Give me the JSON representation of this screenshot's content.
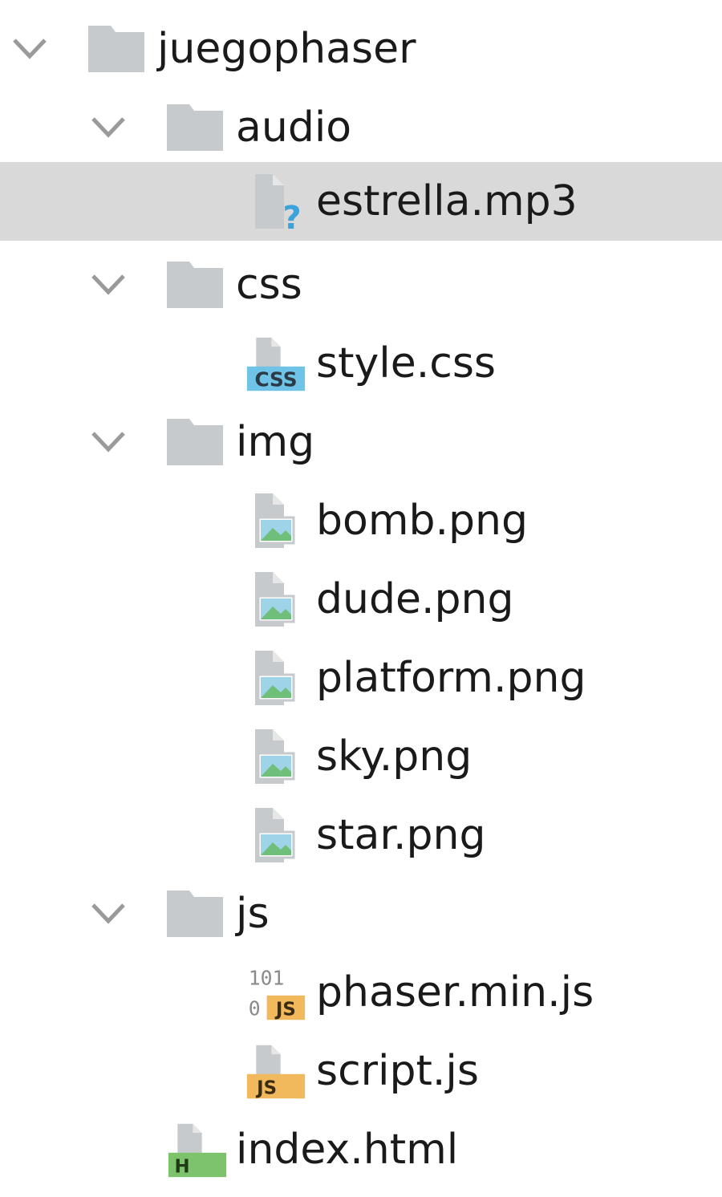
{
  "tree": {
    "root": {
      "label": "juegophaser",
      "icon": "folder-icon",
      "expanded": true
    },
    "audio": {
      "label": "audio",
      "icon": "folder-icon",
      "expanded": true
    },
    "estrella": {
      "label": "estrella.mp3",
      "icon": "unknown-file-icon",
      "selected": true
    },
    "css": {
      "label": "css",
      "icon": "folder-icon",
      "expanded": true
    },
    "style_css": {
      "label": "style.css",
      "icon": "css-file-icon",
      "badge": "CSS"
    },
    "img": {
      "label": "img",
      "icon": "folder-icon",
      "expanded": true
    },
    "images": [
      {
        "label": "bomb.png",
        "icon": "image-file-icon"
      },
      {
        "label": "dude.png",
        "icon": "image-file-icon"
      },
      {
        "label": "platform.png",
        "icon": "image-file-icon"
      },
      {
        "label": "sky.png",
        "icon": "image-file-icon"
      },
      {
        "label": "star.png",
        "icon": "image-file-icon"
      }
    ],
    "js": {
      "label": "js",
      "icon": "folder-icon",
      "expanded": true
    },
    "phaser": {
      "label": "phaser.min.js",
      "icon": "binary-js-file-icon",
      "badge": "JS",
      "bits_top": "101",
      "bits_bottom": "0"
    },
    "script": {
      "label": "script.js",
      "icon": "js-file-icon",
      "badge": "JS"
    },
    "index": {
      "label": "index.html",
      "icon": "html-file-icon",
      "badge": "H"
    }
  },
  "colors": {
    "folder": "#c7cacd",
    "selected_row": "#d9d9d9",
    "css_badge": "#6fc3e6",
    "js_badge": "#f2b95c",
    "html_badge": "#7cc36b",
    "image_green": "#6fbf7a",
    "image_blue": "#9fd4e8",
    "unknown_mark": "#3aa3dc"
  }
}
